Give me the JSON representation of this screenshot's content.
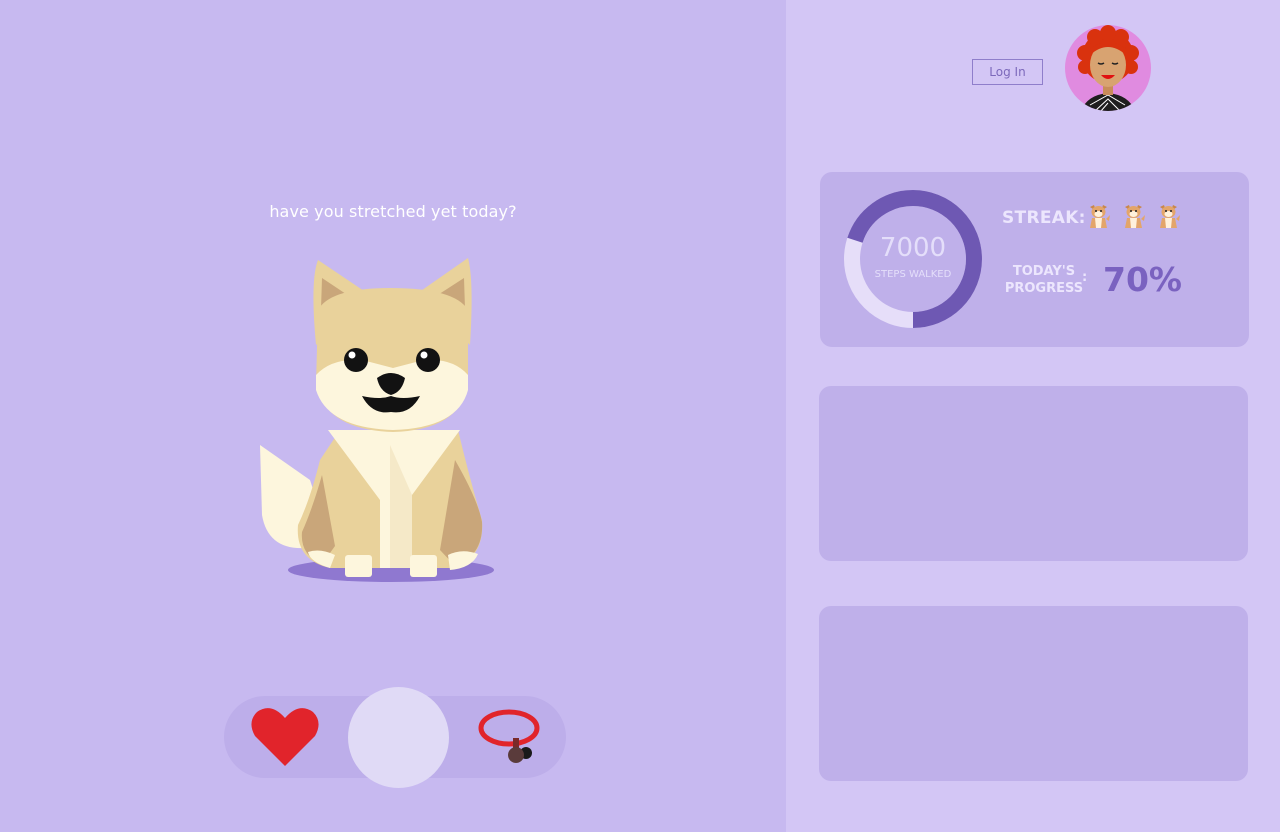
{
  "colors": {
    "left_panel_bg": "#c7b9f0",
    "right_panel_bg": "#d3c6f5",
    "card_bg": "#bfb0ea",
    "ring_filled": "#6e58b3",
    "ring_remaining": "#e6def9",
    "accent_text": "#7a62c0",
    "heart": "#e1242b",
    "collar": "#e1242b"
  },
  "main": {
    "prompt_text": "have you stretched yet today?"
  },
  "header": {
    "login_label": "Log In"
  },
  "stats": {
    "steps_count": "7000",
    "steps_label": "STEPS WALKED",
    "ring_progress": 0.7,
    "streak_label": "STREAK:",
    "streak_count": 3,
    "progress_label_line1": "TODAY'S",
    "progress_label_line2": "PROGRESS",
    "progress_colon": ":",
    "progress_value": "70%"
  },
  "actions": {
    "items": [
      "heart-icon",
      "center-button",
      "collar-icon"
    ]
  }
}
